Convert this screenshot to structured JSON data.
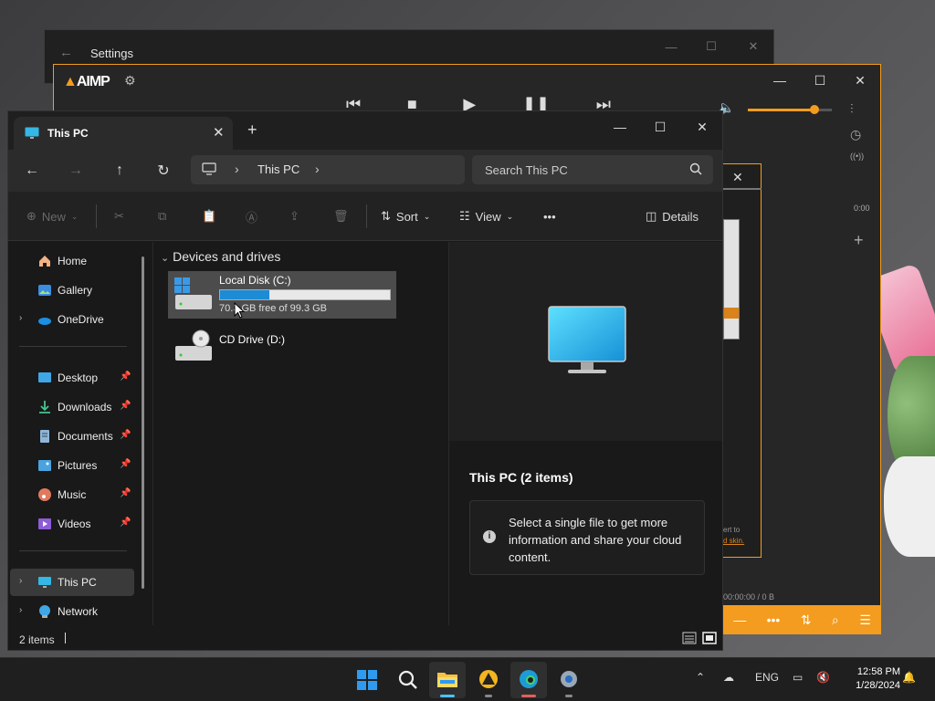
{
  "settings": {
    "title": "Settings"
  },
  "aimp": {
    "logo": "AIMP",
    "time": "0:00",
    "status": "00:00:00 / 0 B",
    "side_text_1": "ert to",
    "side_text_2": "d skin.",
    "volume_fraction": 0.78,
    "accent": "#f39c1f"
  },
  "explorer": {
    "tab_title": "This PC",
    "address": {
      "crumb": "This PC"
    },
    "search": {
      "placeholder": "Search This PC"
    },
    "toolbar": {
      "new": "New",
      "sort": "Sort",
      "view": "View",
      "details": "Details"
    },
    "sidebar": {
      "top": [
        {
          "label": "Home"
        },
        {
          "label": "Gallery"
        },
        {
          "label": "OneDrive"
        }
      ],
      "quick": [
        {
          "label": "Desktop"
        },
        {
          "label": "Downloads"
        },
        {
          "label": "Documents"
        },
        {
          "label": "Pictures"
        },
        {
          "label": "Music"
        },
        {
          "label": "Videos"
        }
      ],
      "bottom": [
        {
          "label": "This PC"
        },
        {
          "label": "Network"
        }
      ]
    },
    "group_header": "Devices and drives",
    "drives": [
      {
        "name": "Local Disk (C:)",
        "free": "70.3 GB free of 99.3 GB",
        "used_fraction": 0.29
      },
      {
        "name": "CD Drive (D:)"
      }
    ],
    "details_pane": {
      "title": "This PC (2 items)",
      "message": "Select a single file to get more information and share your cloud content."
    },
    "status": {
      "count": "2 items"
    }
  },
  "taskbar": {
    "language": "ENG",
    "time": "12:58 PM",
    "date": "1/28/2024"
  }
}
